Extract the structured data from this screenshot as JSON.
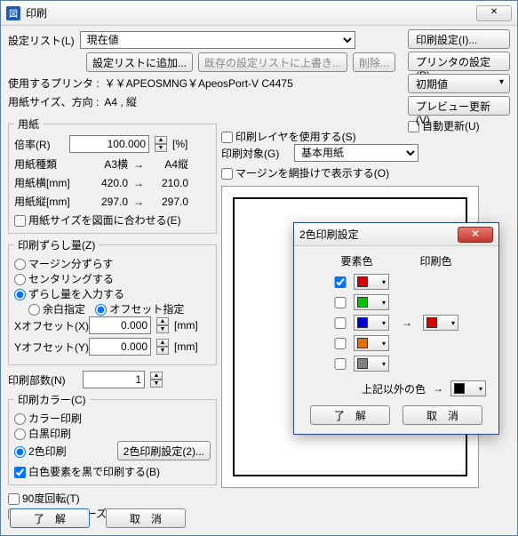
{
  "window": {
    "title": "印刷",
    "close": "X"
  },
  "settings": {
    "list_label": "設定リスト(L)",
    "current_value": "現在値",
    "add_btn": "設定リストに追加...",
    "overwrite_btn": "既存の設定リストに上書き...",
    "delete_btn": "削除..."
  },
  "right_buttons": {
    "print_settings": "印刷設定(I)...",
    "printer_settings": "プリンタの設定(P)...",
    "default": "初期値",
    "preview_update": "プレビュー更新(V)",
    "auto_update": "自動更新(U)"
  },
  "printer": {
    "label": "使用するプリンタ  :",
    "value": "￥￥APEOSMNG￥ApeosPort-V C4475"
  },
  "paper_size_dir": {
    "label": "用紙サイズ、方向  :",
    "value": "A4 , 縦"
  },
  "paper": {
    "legend": "用紙",
    "ratio_label": "倍率(R)",
    "ratio_value": "100.000",
    "percent": "[%]",
    "type_label": "用紙種類",
    "type_from": "A3横",
    "arrow": "→",
    "type_to": "A4縦",
    "width_label": "用紙横[mm]",
    "width_from": "420.0",
    "width_to": "210.0",
    "height_label": "用紙縦[mm]",
    "height_from": "297.0",
    "height_to": "297.0",
    "fit_label": "用紙サイズを図面に合わせる(E)"
  },
  "offset": {
    "legend": "印刷ずらし量(Z)",
    "opt_margin": "マージン分ずらす",
    "opt_center": "センタリングする",
    "opt_input": "ずらし量を入力する",
    "opt_blank": "余白指定",
    "opt_offset": "オフセット指定",
    "x_label": "Xオフセット(X)",
    "x_value": "0.000",
    "mm": "[mm]",
    "y_label": "Yオフセット(Y)",
    "y_value": "0.000"
  },
  "copies": {
    "label": "印刷部数(N)",
    "value": "1"
  },
  "color": {
    "legend": "印刷カラー(C)",
    "opt_color": "カラー印刷",
    "opt_bw": "白黒印刷",
    "opt_2c": "2色印刷",
    "btn_2c": "2色印刷設定(2)...",
    "white_black": "白色要素を黒で印刷する(B)"
  },
  "misc": {
    "rotate90": "90度回転(T)",
    "smooth": "ラスタにスムーズ処理を行う(A)"
  },
  "right_area": {
    "use_layer": "印刷レイヤを使用する(S)",
    "target_label": "印刷対象(G)",
    "target_value": "基本用紙",
    "margin_hatch": "マージンを網掛けで表示する(O)"
  },
  "footer": {
    "ok": "了　解",
    "cancel": "取　消"
  },
  "subdlg": {
    "title": "2色印刷設定",
    "hdr_elem": "要素色",
    "hdr_print": "印刷色",
    "rows": [
      {
        "checked": true,
        "color": "#d80000"
      },
      {
        "checked": false,
        "color": "#00c400"
      },
      {
        "checked": false,
        "color": "#0000d8"
      },
      {
        "checked": false,
        "color": "#e07000"
      },
      {
        "checked": false,
        "color": "#808080"
      }
    ],
    "arrow": "→",
    "print_color": "#d80000",
    "other_label": "上記以外の色",
    "other_color": "#000000",
    "ok": "了　解",
    "cancel": "取　消"
  }
}
